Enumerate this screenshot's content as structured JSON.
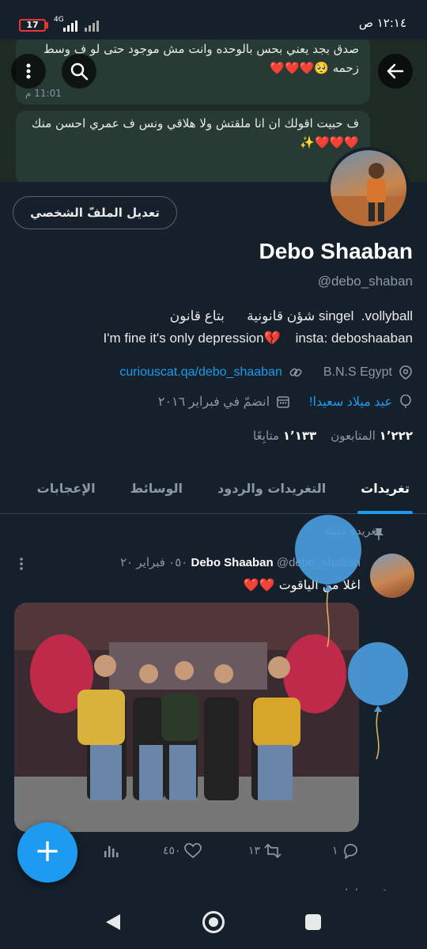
{
  "status_bar": {
    "time": "١٢:١٤ ص",
    "battery": "17",
    "network": "4G"
  },
  "banner": {
    "bubble1_text": "صدق بجد يعني بحس بالوحده وانت مش موجود حتى لو ف وسط زحمه 🥺❤️❤️❤️",
    "bubble1_time": "11:01 م",
    "bubble2_text": "ف حبيت اقولك ان انا ملقتش ولا هلاقي ونس ف عمري احسن منك ❤️❤️❤️✨"
  },
  "profile": {
    "edit_button": "تعديل الملفّ الشخصي",
    "name": "Debo Shaaban",
    "handle": "@debo_shaban",
    "bio_line1": "شؤن قانونية      بتاع قانون singel  .vollyball",
    "bio_line2": "I'm fine it's only depression💔    insta: deboshaaban",
    "location": "B.N.S Egypt",
    "website": "curiouscat.qa/debo_shaaban",
    "birthday": "عيد ميلاد سعيدا!",
    "joined": "انضمّ في فبراير ٢٠١٦",
    "followers_count": "١٬٢٢٢",
    "followers_label": "المتابعون",
    "following_count": "١٬١٣٣",
    "following_label": "متابِعًا"
  },
  "tabs": [
    "تغريدات",
    "التغريدات والردود",
    "الوسائط",
    "الإعجابات"
  ],
  "tweet": {
    "pinned_label": "تغريدة مثبتة",
    "author_name": "Debo Shaaban",
    "author_handle": "@debo_shaban",
    "date": "٠٥٠ فبراير ٢٠",
    "text": "اغلا من الياقوت ❤️❤️",
    "replies": "١",
    "retweets": "١٣",
    "likes": "٤٥٠"
  },
  "retweet_peek": "قمت بإعادة تغري",
  "fab_label": "+",
  "colors": {
    "accent": "#1d9bf0",
    "background": "#15202b",
    "border": "#38444d",
    "muted": "#8b98a5"
  }
}
